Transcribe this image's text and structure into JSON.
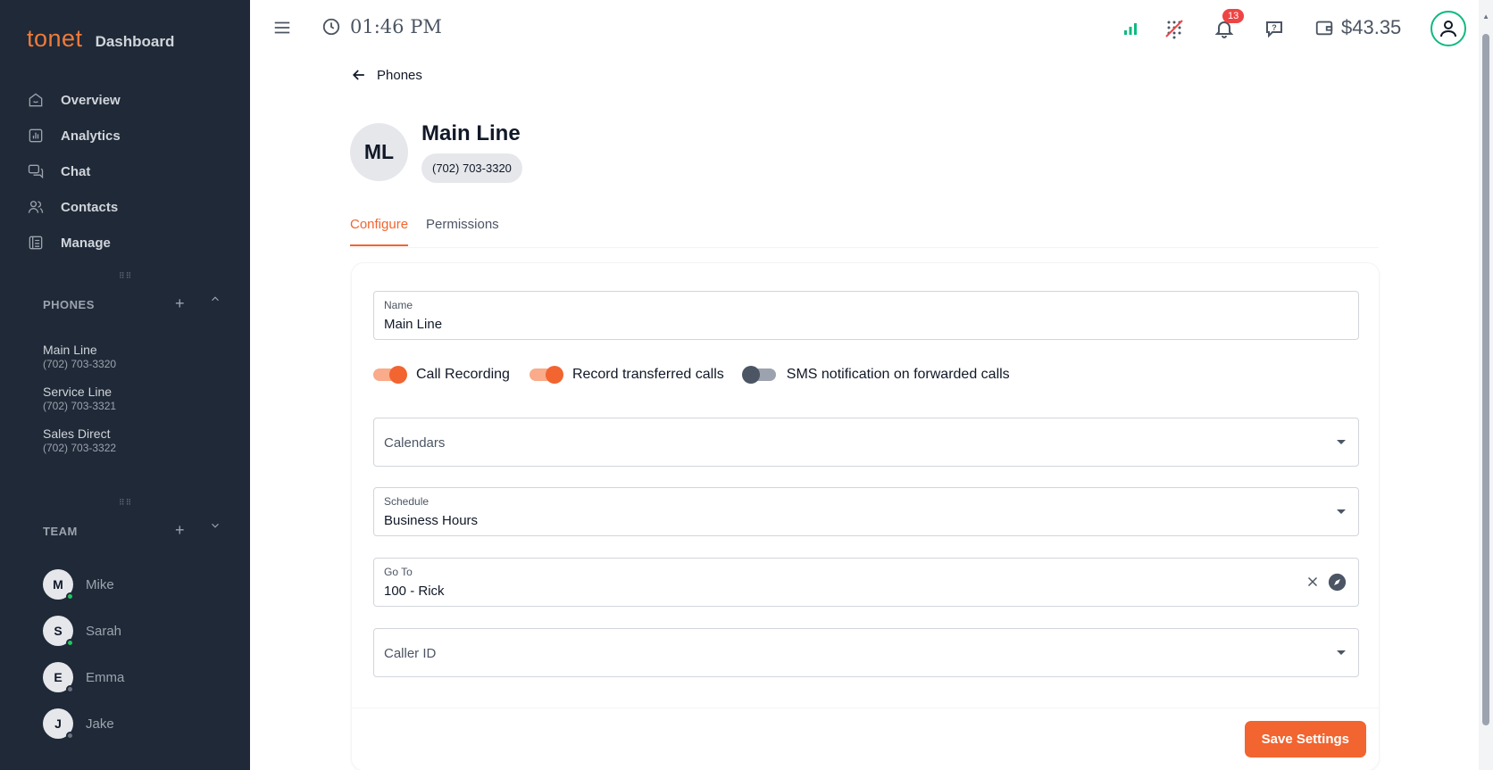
{
  "brand": {
    "logo": "tonet",
    "title": "Dashboard"
  },
  "nav": [
    {
      "label": "Overview",
      "icon": "home-icon"
    },
    {
      "label": "Analytics",
      "icon": "analytics-icon"
    },
    {
      "label": "Chat",
      "icon": "chat-icon"
    },
    {
      "label": "Contacts",
      "icon": "contacts-icon"
    },
    {
      "label": "Manage",
      "icon": "manage-icon"
    }
  ],
  "phones": {
    "title": "PHONES",
    "add": "+",
    "items": [
      {
        "name": "Main Line",
        "number": "(702) 703-3320"
      },
      {
        "name": "Service Line",
        "number": "(702) 703-3321"
      },
      {
        "name": "Sales Direct",
        "number": "(702) 703-3322"
      }
    ]
  },
  "team": {
    "title": "TEAM",
    "add": "+",
    "members": [
      {
        "initial": "M",
        "name": "Mike",
        "status": "online"
      },
      {
        "initial": "S",
        "name": "Sarah",
        "status": "online"
      },
      {
        "initial": "E",
        "name": "Emma",
        "status": "offline"
      },
      {
        "initial": "J",
        "name": "Jake",
        "status": "offline"
      }
    ]
  },
  "topbar": {
    "time": "01:46 PM",
    "notifications": "13",
    "balance": "$43.35",
    "icons": [
      "menu-icon",
      "clock-icon",
      "signal-icon",
      "dialpad-off-icon",
      "bell-icon",
      "help-icon",
      "wallet-icon",
      "profile-icon"
    ]
  },
  "page": {
    "back_label": "Phones",
    "avatar": "ML",
    "title": "Main Line",
    "number": "(702) 703-3320",
    "tabs": [
      "Configure",
      "Permissions"
    ],
    "active_tab": "Configure"
  },
  "form": {
    "name": {
      "label": "Name",
      "value": "Main Line"
    },
    "toggles": [
      {
        "label": "Call Recording",
        "on": true
      },
      {
        "label": "Record transferred calls",
        "on": true
      },
      {
        "label": "SMS notification on forwarded calls",
        "on": false
      }
    ],
    "calendars": {
      "placeholder": "Calendars"
    },
    "schedule": {
      "label": "Schedule",
      "value": "Business Hours"
    },
    "goto": {
      "label": "Go To",
      "value": "100 - Rick"
    },
    "caller_id": {
      "placeholder": "Caller ID"
    },
    "save_label": "Save Settings"
  },
  "colors": {
    "accent": "#f26430",
    "sidebar": "#1f2937",
    "online": "#22c55e",
    "offline": "#6b7280",
    "badge": "#ef4444"
  }
}
